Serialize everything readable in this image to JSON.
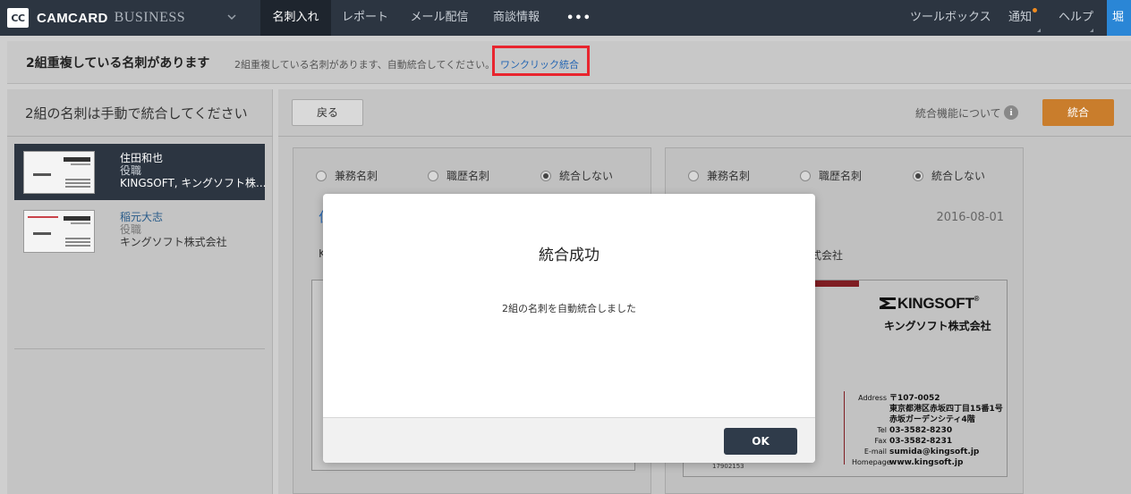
{
  "app": {
    "logo_badge": "CC",
    "brand": "CAMCARD",
    "brand_sub": "BUSINESS"
  },
  "nav": {
    "items": [
      {
        "label": "名刺入れ",
        "active": true
      },
      {
        "label": "レポート",
        "active": false
      },
      {
        "label": "メール配信",
        "active": false
      },
      {
        "label": "商談情報",
        "active": false
      }
    ],
    "more": "•••",
    "toolbox": "ツールボックス",
    "notice": "通知",
    "help": "ヘルプ",
    "user": "堀"
  },
  "notice_bar": {
    "title": "2組重複している名刺があります",
    "description": "2組重複している名刺があります、自動統合してください。",
    "link": "ワンクリック統合"
  },
  "left": {
    "title": "2組の名刺は手動で統合してください",
    "cards": [
      {
        "name": "住田和也",
        "title": "役職",
        "company": "KINGSOFT, キングソフト株...",
        "selected": true
      },
      {
        "name": "稲元大志",
        "title": "役職",
        "company": "キングソフト株式会社",
        "selected": false
      }
    ]
  },
  "toolbar": {
    "back": "戻る",
    "about": "統合機能について",
    "info_icon": "i",
    "merge": "統合"
  },
  "panels": [
    {
      "options": [
        "兼務名刺",
        "職歴名刺",
        "統合しない"
      ],
      "selected_index": 2,
      "name_initial": "住",
      "company_initial": "K"
    },
    {
      "options": [
        "兼務名刺",
        "職歴名刺",
        "統合しない"
      ],
      "selected_index": 2,
      "date": "2016-08-01",
      "company_fragment": "式会社",
      "card_image": {
        "logo": "KINGSOFT",
        "logo_reg": "®",
        "company_jp": "キングソフト株式会社",
        "address_label": "Address",
        "address_lines": [
          "〒107-0052",
          "東京都港区赤坂四丁目15番1号",
          "赤坂ガーデンシティ4階"
        ],
        "tel_label": "Tel",
        "tel": "03-3582-8230",
        "fax_label": "Fax",
        "fax": "03-3582-8231",
        "email_label": "E-mail",
        "email": "sumida@kingsoft.jp",
        "homepage_label": "Homepage",
        "homepage": "www.kingsoft.jp",
        "number": "17902153"
      }
    }
  ],
  "modal": {
    "title": "統合成功",
    "message": "2組の名刺を自動統合しました",
    "ok": "OK"
  },
  "colors": {
    "topbar": "#2c3541",
    "accent_orange": "#c97d2c",
    "highlight_red": "#e8252e",
    "link_blue": "#2466b3",
    "user_blue": "#2a86d6"
  }
}
